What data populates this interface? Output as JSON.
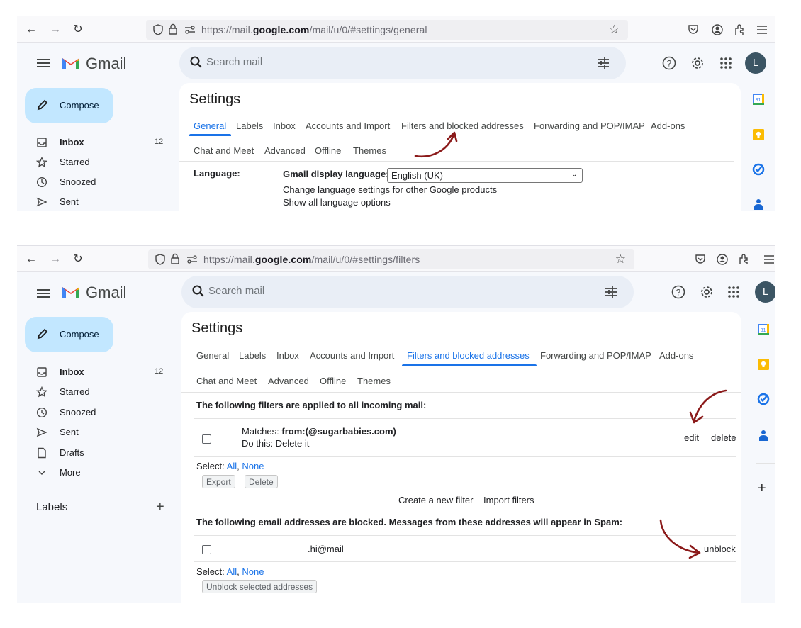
{
  "screens": [
    {
      "browser": {
        "url_prefix": "https://mail.",
        "url_domain": "google.com",
        "url_path": "/mail/u/0/#settings/general"
      },
      "header": {
        "app_name": "Gmail",
        "search_placeholder": "Search mail",
        "avatar_letter": "L"
      },
      "sidebar": {
        "compose_label": "Compose",
        "items": [
          {
            "label": "Inbox",
            "count": "12",
            "icon": "inbox-icon"
          },
          {
            "label": "Starred",
            "icon": "star-icon"
          },
          {
            "label": "Snoozed",
            "icon": "clock-icon"
          },
          {
            "label": "Sent",
            "icon": "send-icon"
          }
        ]
      },
      "settings": {
        "title": "Settings",
        "tabs_row1": [
          "General",
          "Labels",
          "Inbox",
          "Accounts and Import",
          "Filters and blocked addresses",
          "Forwarding and POP/IMAP",
          "Add-ons"
        ],
        "tabs_row2": [
          "Chat and Meet",
          "Advanced",
          "Offline",
          "Themes"
        ],
        "active_tab": "General",
        "language_label": "Language:",
        "display_language_label": "Gmail display language:",
        "display_language_value": "English (UK)",
        "change_language_link": "Change language settings for other Google products",
        "show_all_languages_link": "Show all language options"
      }
    },
    {
      "browser": {
        "url_prefix": "https://mail.",
        "url_domain": "google.com",
        "url_path": "/mail/u/0/#settings/filters"
      },
      "header": {
        "app_name": "Gmail",
        "search_placeholder": "Search mail",
        "avatar_letter": "L"
      },
      "sidebar": {
        "compose_label": "Compose",
        "items": [
          {
            "label": "Inbox",
            "count": "12",
            "icon": "inbox-icon"
          },
          {
            "label": "Starred",
            "icon": "star-icon"
          },
          {
            "label": "Snoozed",
            "icon": "clock-icon"
          },
          {
            "label": "Sent",
            "icon": "send-icon"
          },
          {
            "label": "Drafts",
            "icon": "draft-icon"
          },
          {
            "label": "More",
            "icon": "chevron-down-icon"
          }
        ],
        "labels_header": "Labels",
        "labels_add": "+"
      },
      "settings": {
        "title": "Settings",
        "tabs_row1": [
          "General",
          "Labels",
          "Inbox",
          "Accounts and Import",
          "Filters and blocked addresses",
          "Forwarding and POP/IMAP",
          "Add-ons"
        ],
        "tabs_row2": [
          "Chat and Meet",
          "Advanced",
          "Offline",
          "Themes"
        ],
        "active_tab": "Filters and blocked addresses",
        "filters_title": "The following filters are applied to all incoming mail:",
        "filters": [
          {
            "matches_label": "Matches:",
            "matches_value": "from:(@sugarbabies.com)",
            "action": "Do this: Delete it",
            "edit": "edit",
            "delete": "delete"
          }
        ],
        "select_label": "Select:",
        "select_all": "All",
        "select_sep": ",",
        "select_none": "None",
        "export_button": "Export",
        "delete_button": "Delete",
        "create_filter_link": "Create a new filter",
        "import_filters_link": "Import filters",
        "blocked_title": "The following email addresses are blocked. Messages from these addresses will appear in Spam:",
        "blocked": [
          {
            "address": ".hi@mail",
            "unblock": "unblock"
          }
        ],
        "unblock_selected_button": "Unblock selected addresses"
      },
      "right_rail": {
        "add_label": "+"
      }
    }
  ],
  "annotation_color": "#8b1a1a"
}
